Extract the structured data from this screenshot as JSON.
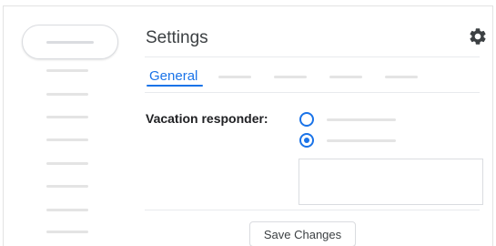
{
  "header": {
    "title": "Settings",
    "settings_icon": "gear-icon"
  },
  "tabs": {
    "active_label": "General"
  },
  "vacation": {
    "label": "Vacation responder:",
    "selected_option_index": 1,
    "message": ""
  },
  "actions": {
    "save_label": "Save Changes"
  },
  "colors": {
    "accent": "#1a73e8",
    "text": "#202124",
    "placeholder": "#e4e4e4"
  }
}
